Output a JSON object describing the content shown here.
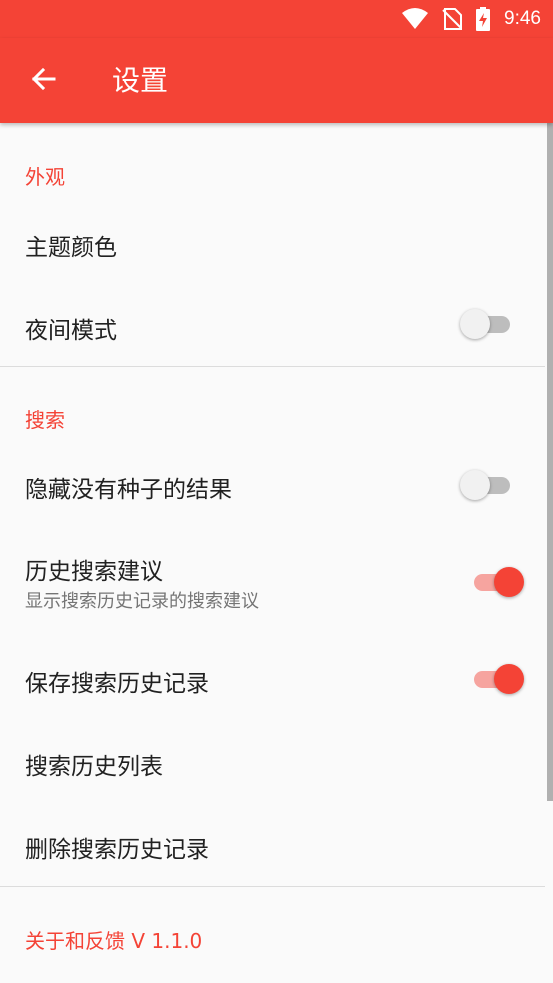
{
  "status_bar": {
    "time": "9:46"
  },
  "app_bar": {
    "title": "设置",
    "back_icon": "arrow-back-icon"
  },
  "theme": {
    "accent": "#f44336"
  },
  "sections": {
    "appearance": {
      "title": "外观",
      "theme_color": {
        "title": "主题颜色"
      },
      "night_mode": {
        "title": "夜间模式",
        "enabled": false
      }
    },
    "search": {
      "title": "搜索",
      "hide_no_seed": {
        "title": "隐藏没有种子的结果",
        "enabled": false
      },
      "history_suggest": {
        "title": "历史搜索建议",
        "subtitle": "显示搜索历史记录的搜索建议",
        "enabled": true
      },
      "save_history": {
        "title": "保存搜索历史记录",
        "enabled": true
      },
      "history_list": {
        "title": "搜索历史列表"
      },
      "delete_history": {
        "title": "删除搜索历史记录"
      }
    },
    "about": {
      "title": "关于和反馈 V 1.1.0"
    }
  }
}
